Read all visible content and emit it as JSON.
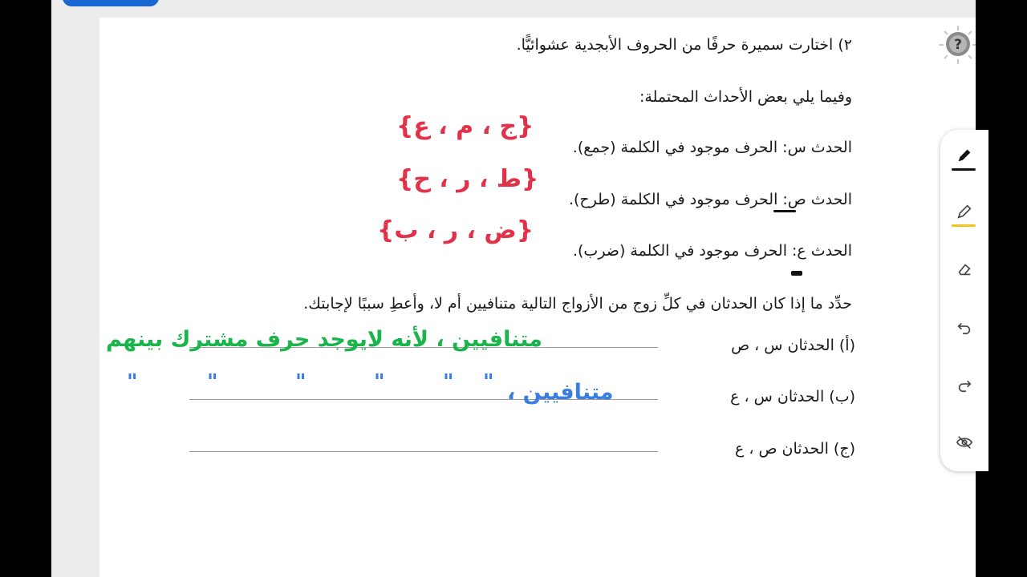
{
  "question": {
    "number": "٢)",
    "text": "اختارت سميرة حرفًا من الحروف الأبجدية عشوائيًّا."
  },
  "intro": "وفيما يلي بعض الأحداث المحتملة:",
  "events": [
    {
      "label": "الحدث س: الحرف موجود في الكلمة (جمع).",
      "handwriting": "{ج ، م ، ع}"
    },
    {
      "label": "الحدث ص: الحرف موجود في الكلمة (طرح).",
      "handwriting": "{ط ، ر ، ح}"
    },
    {
      "label": "الحدث ع: الحرف موجود في الكلمة (ضرب).",
      "handwriting": "{ض ، ر ، ب}"
    }
  ],
  "instruction": "حدِّد ما إذا كان الحدثان في كلِّ زوج من الأزواج التالية متنافيين أم لا، وأعطِ سببًا لإجابتك.",
  "pairs": [
    {
      "label": "(أ)   الحدثان س ، ص",
      "answer": "متنافيين ، لأنه لايوجد حرف مشترك بينهم"
    },
    {
      "label": "(ب)  الحدثان س ، ع",
      "answer": "متنافيين ،",
      "ditto": [
        "\"",
        "\"",
        "\"",
        "\"",
        "\"",
        "\""
      ]
    },
    {
      "label": "(ج)   الحدثان ص ، ع",
      "answer": ""
    }
  ],
  "toolbar": {
    "tools": [
      "pen-icon",
      "highlighter-icon",
      "eraser-icon",
      "undo-icon",
      "redo-icon",
      "hide-icon"
    ],
    "pen_accent": "#111111",
    "highlighter_accent": "#f2c318"
  },
  "colors": {
    "ink_red": "#e2324a",
    "ink_green": "#19b44a",
    "ink_blue": "#3a7ee0"
  }
}
